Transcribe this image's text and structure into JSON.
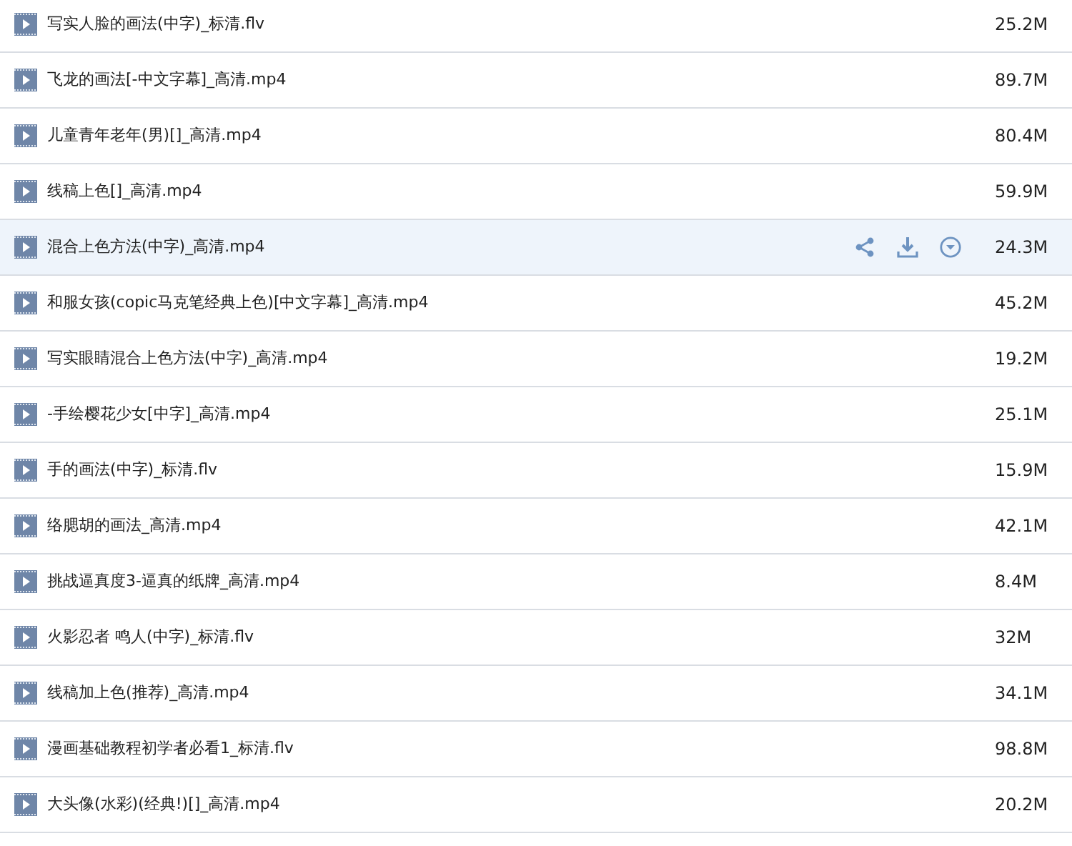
{
  "files": [
    {
      "name": "写实人脸的画法(中字)_标清.flv",
      "size": "25.2M",
      "selected": false
    },
    {
      "name": "飞龙的画法[-中文字幕]_高清.mp4",
      "size": "89.7M",
      "selected": false
    },
    {
      "name": "儿童青年老年(男)[]_高清.mp4",
      "size": "80.4M",
      "selected": false
    },
    {
      "name": "线稿上色[]_高清.mp4",
      "size": "59.9M",
      "selected": false
    },
    {
      "name": "混合上色方法(中字)_高清.mp4",
      "size": "24.3M",
      "selected": true
    },
    {
      "name": "和服女孩(copic马克笔经典上色)[中文字幕]_高清.mp4",
      "size": "45.2M",
      "selected": false
    },
    {
      "name": "写实眼睛混合上色方法(中字)_高清.mp4",
      "size": "19.2M",
      "selected": false
    },
    {
      "name": "-手绘樱花少女[中字]_高清.mp4",
      "size": "25.1M",
      "selected": false
    },
    {
      "name": "手的画法(中字)_标清.flv",
      "size": "15.9M",
      "selected": false
    },
    {
      "name": "络腮胡的画法_高清.mp4",
      "size": "42.1M",
      "selected": false
    },
    {
      "name": "挑战逼真度3-逼真的纸牌_高清.mp4",
      "size": "8.4M",
      "selected": false
    },
    {
      "name": "火影忍者 鸣人(中字)_标清.flv",
      "size": "32M",
      "selected": false
    },
    {
      "name": "线稿加上色(推荐)_高清.mp4",
      "size": "34.1M",
      "selected": false
    },
    {
      "name": "漫画基础教程初学者必看1_标清.flv",
      "size": "98.8M",
      "selected": false
    },
    {
      "name": "大头像(水彩)(经典!)[]_高清.mp4",
      "size": "20.2M",
      "selected": false
    }
  ]
}
